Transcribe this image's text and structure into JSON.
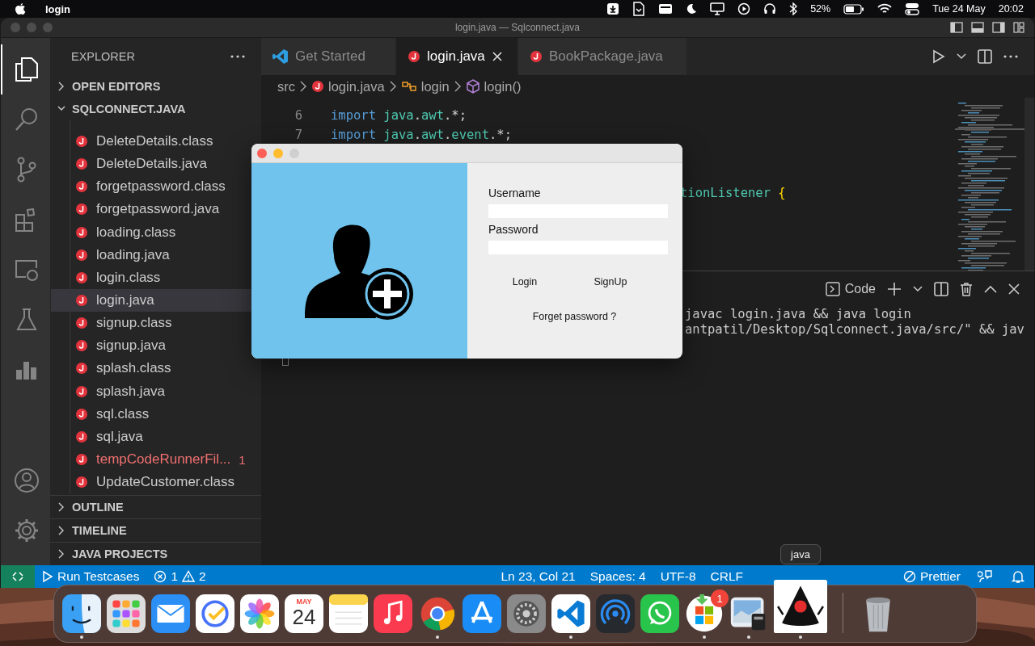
{
  "menu_bar": {
    "app_name": "login",
    "battery": "52%",
    "date": "Tue 24 May",
    "time": "20:02"
  },
  "window": {
    "title": "login.java — Sqlconnect.java"
  },
  "activity_bar": {
    "top": [
      {
        "kind": "files",
        "selected": true
      },
      {
        "kind": "search",
        "selected": false
      },
      {
        "kind": "source-control",
        "selected": false
      },
      {
        "kind": "extensions",
        "selected": false
      },
      {
        "kind": "remote",
        "selected": false
      },
      {
        "kind": "testing",
        "selected": false
      },
      {
        "kind": "chart",
        "selected": false
      }
    ],
    "bottom": [
      {
        "kind": "account",
        "selected": false
      },
      {
        "kind": "settings",
        "selected": false
      }
    ]
  },
  "sidebar": {
    "title": "EXPLORER",
    "sections": [
      {
        "label": "OPEN EDITORS",
        "expanded": false
      },
      {
        "label": "SQLCONNECT.JAVA",
        "expanded": true
      }
    ],
    "files": [
      {
        "name": "DeleteDetails.class",
        "selected": false,
        "error": false
      },
      {
        "name": "DeleteDetails.java",
        "selected": false,
        "error": false
      },
      {
        "name": "forgetpassword.class",
        "selected": false,
        "error": false
      },
      {
        "name": "forgetpassword.java",
        "selected": false,
        "error": false
      },
      {
        "name": "loading.class",
        "selected": false,
        "error": false
      },
      {
        "name": "loading.java",
        "selected": false,
        "error": false
      },
      {
        "name": "login.class",
        "selected": false,
        "error": false
      },
      {
        "name": "login.java",
        "selected": true,
        "error": false
      },
      {
        "name": "signup.class",
        "selected": false,
        "error": false
      },
      {
        "name": "signup.java",
        "selected": false,
        "error": false
      },
      {
        "name": "splash.class",
        "selected": false,
        "error": false
      },
      {
        "name": "splash.java",
        "selected": false,
        "error": false
      },
      {
        "name": "sql.class",
        "selected": false,
        "error": false
      },
      {
        "name": "sql.java",
        "selected": false,
        "error": false
      },
      {
        "name": "tempCodeRunnerFil...",
        "selected": false,
        "error": true,
        "badge": "1"
      },
      {
        "name": "UpdateCustomer.class",
        "selected": false,
        "error": false
      }
    ],
    "bottom_sections": [
      {
        "label": "OUTLINE",
        "expanded": false
      },
      {
        "label": "TIMELINE",
        "expanded": false
      },
      {
        "label": "JAVA PROJECTS",
        "expanded": false
      }
    ]
  },
  "tabs": [
    {
      "label": "Get Started",
      "kind": "welcome",
      "selected": false
    },
    {
      "label": "login.java",
      "kind": "java",
      "selected": true
    },
    {
      "label": "BookPackage.java",
      "kind": "java",
      "selected": false
    }
  ],
  "breadcrumbs": [
    {
      "label": "src",
      "kind": "folder"
    },
    {
      "label": "login.java",
      "kind": "java"
    },
    {
      "label": "login",
      "kind": "class"
    },
    {
      "label": "login()",
      "kind": "method"
    }
  ],
  "code_lines": [
    {
      "kind": "full",
      "number": "6",
      "tokens": [
        {
          "text": "import",
          "kind": "keyword"
        },
        {
          "text": "java",
          "kind": "package"
        },
        {
          "text": ".",
          "kind": "plain"
        },
        {
          "text": "awt",
          "kind": "package"
        },
        {
          "text": ".*;",
          "kind": "plain"
        }
      ]
    },
    {
      "kind": "full",
      "number": "7",
      "tokens": [
        {
          "text": "import",
          "kind": "keyword"
        },
        {
          "text": "java",
          "kind": "package"
        },
        {
          "text": ".",
          "kind": "plain"
        },
        {
          "text": "awt",
          "kind": "package"
        },
        {
          "text": ".",
          "kind": "plain"
        },
        {
          "text": "event",
          "kind": "package"
        },
        {
          "text": ".*;",
          "kind": "plain"
        }
      ]
    },
    {
      "kind": "blank"
    },
    {
      "kind": "blank"
    },
    {
      "kind": "partial",
      "tokens": [
        {
          "text": "tionListener",
          "kind": "type"
        },
        {
          "text": "{",
          "kind": "brace"
        }
      ]
    }
  ],
  "terminal": {
    "profile": "Code",
    "lines": [
      "javac login.java && java login",
      "antpatil/Desktop/Sqlconnect.java/src/\" && jav"
    ]
  },
  "status_bar": {
    "run": "Run Testcases",
    "errors": "1",
    "warnings": "2",
    "items": [
      "Ln 23, Col 21",
      "Spaces: 4",
      "UTF-8",
      "CRLF"
    ],
    "formatter": "Prettier"
  },
  "dialog": {
    "username_label": "Username",
    "password_label": "Password",
    "buttons": [
      "Login",
      "SignUp"
    ],
    "link": "Forget password ?"
  },
  "dock": {
    "tooltip": "java",
    "apps": [
      {
        "kind": "finder",
        "running": true,
        "hovered": false
      },
      {
        "kind": "launchpad",
        "running": false,
        "hovered": false
      },
      {
        "kind": "mail",
        "running": false,
        "hovered": false
      },
      {
        "kind": "tasks",
        "running": false,
        "hovered": false
      },
      {
        "kind": "photos",
        "running": false,
        "hovered": false
      },
      {
        "kind": "calendar",
        "running": false,
        "hovered": false,
        "month": "MAY",
        "day": "24"
      },
      {
        "kind": "notes",
        "running": false,
        "hovered": false
      },
      {
        "kind": "music",
        "running": false,
        "hovered": false
      },
      {
        "kind": "chrome",
        "running": true,
        "hovered": false
      },
      {
        "kind": "appstore",
        "running": false,
        "hovered": false
      },
      {
        "kind": "settings",
        "running": false,
        "hovered": false
      },
      {
        "kind": "vscode",
        "running": true,
        "hovered": false
      },
      {
        "kind": "broadcast",
        "running": false,
        "hovered": false
      },
      {
        "kind": "whatsapp",
        "running": false,
        "hovered": false
      },
      {
        "kind": "store",
        "running": true,
        "hovered": false,
        "badge": "1"
      },
      {
        "kind": "preview",
        "running": true,
        "hovered": false
      },
      {
        "kind": "java",
        "running": true,
        "hovered": true
      },
      {
        "kind": "trash",
        "running": false,
        "hovered": false
      }
    ]
  }
}
